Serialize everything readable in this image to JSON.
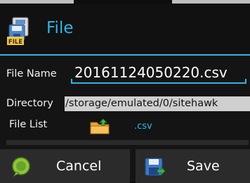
{
  "dialog": {
    "title": "File",
    "title_icon": "file-icon",
    "accent_color": "#2fb5e6"
  },
  "form": {
    "file_name_label": "File Name",
    "file_name_value": "20161124050220.csv",
    "directory_label": "Directory",
    "directory_value": "/storage/emulated/0/sitehawk",
    "file_list_label": "File List",
    "file_list_icon": "folder-icon",
    "file_list_extension": ".csv"
  },
  "buttons": {
    "cancel_label": "Cancel",
    "cancel_icon": "chat-bubble-icon",
    "save_label": "Save",
    "save_icon": "floppy-disk-icon"
  }
}
